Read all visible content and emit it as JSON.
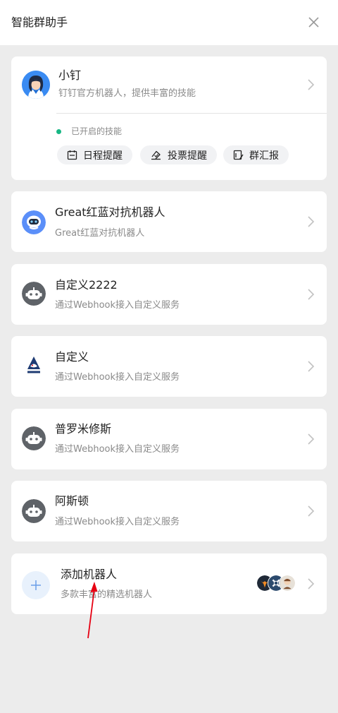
{
  "header": {
    "title": "智能群助手",
    "close_icon": "close-icon"
  },
  "featured_bot": {
    "name": "小钉",
    "description": "钉钉官方机器人，提供丰富的技能",
    "skills_status": "已开启的技能",
    "status_color": "#18b784",
    "skills": [
      {
        "label": "日程提醒",
        "icon": "calendar-icon"
      },
      {
        "label": "投票提醒",
        "icon": "vote-icon"
      },
      {
        "label": "群汇报",
        "icon": "report-icon"
      }
    ]
  },
  "bots": [
    {
      "name": "Great红蓝对抗机器人",
      "description": "Great红蓝对抗机器人",
      "avatar": "robot-blue-avatar"
    },
    {
      "name": "自定义2222",
      "description": "通过Webhook接入自定义服务",
      "avatar": "robot-gray-avatar"
    },
    {
      "name": "自定义",
      "description": "通过Webhook接入自定义服务",
      "avatar": "shark-logo-avatar"
    },
    {
      "name": "普罗米修斯",
      "description": "通过Webhook接入自定义服务",
      "avatar": "robot-gray-avatar"
    },
    {
      "name": "阿斯顿",
      "description": "通过Webhook接入自定义服务",
      "avatar": "robot-gray-avatar"
    }
  ],
  "add_bot": {
    "label": "添加机器人",
    "description": "多款丰富的精选机器人",
    "icon": "plus-icon"
  },
  "colors": {
    "accent_blue": "#5b8ff9",
    "arrow_red": "#e60012"
  }
}
